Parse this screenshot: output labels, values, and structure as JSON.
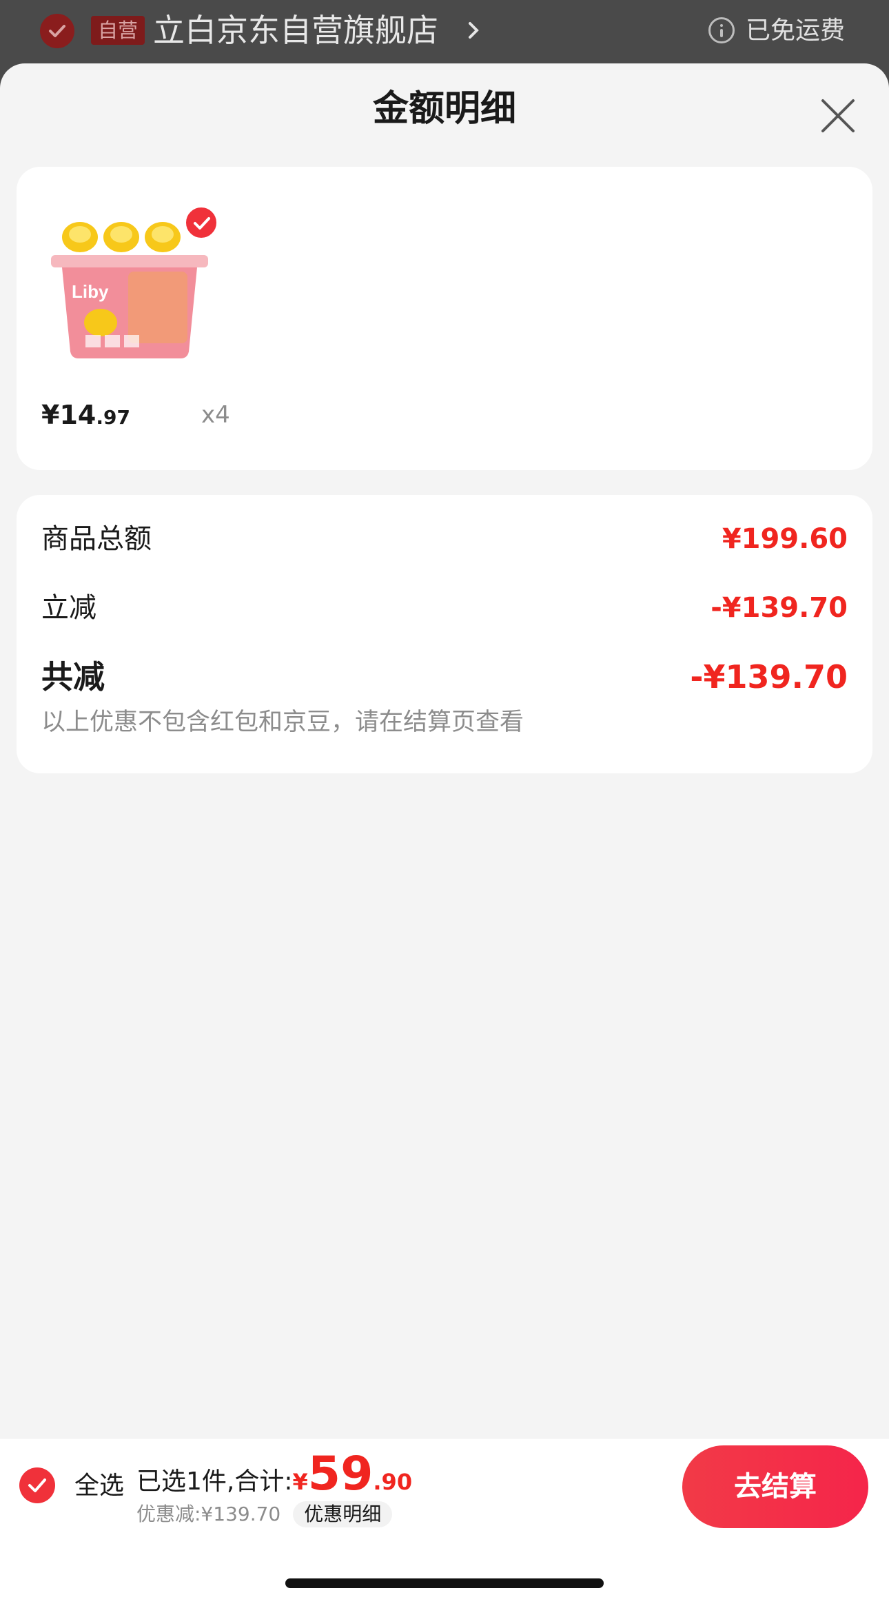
{
  "store_bar": {
    "self_operated_badge": "自营",
    "store_name": "立白京东自营旗舰店",
    "shipping_status": "已免运费"
  },
  "sheet": {
    "title": "金额明细"
  },
  "product": {
    "brand_text": "Liby",
    "price_int": "¥14",
    "price_dec": ".97",
    "quantity": "x4"
  },
  "summary": {
    "rows": [
      {
        "label": "商品总额",
        "value": "¥199.60"
      },
      {
        "label": "立减",
        "value": "-¥139.70"
      },
      {
        "label": "共减",
        "value": "-¥139.70"
      }
    ],
    "note": "以上优惠不包含红包和京豆，请在结算页查看"
  },
  "footer": {
    "select_all_label": "全选",
    "selected_text": "已选1件,合计:",
    "currency": "¥",
    "total_int": "59",
    "total_dec": ".90",
    "discount_text": "优惠减:¥139.70",
    "detail_chip": "优惠明细",
    "checkout_label": "去结算"
  },
  "colors": {
    "accent_red": "#f0251f",
    "button_red": "#f23a47",
    "sheet_bg": "#f4f4f4"
  }
}
